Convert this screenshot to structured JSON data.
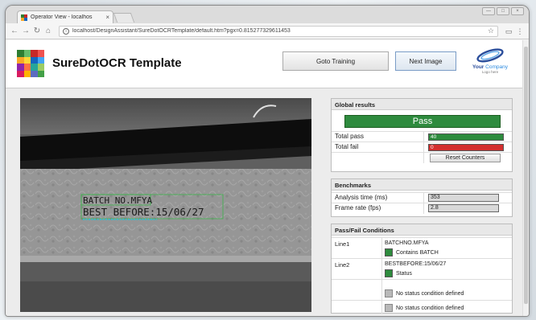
{
  "browser": {
    "tab_title": "Operator View - localhos",
    "tab_close": "×",
    "url": "localhost/DesignAssistant/SureDotOCRTemplate/default.htm?pgx=0.815277329611453",
    "win_controls": [
      "—",
      "□",
      "×"
    ]
  },
  "header": {
    "app_title": "SureDotOCR Template",
    "goto_training_label": "Goto Training",
    "next_image_label": "Next Image",
    "company_name_part1": "Your",
    "company_name_part2": "Company",
    "company_tagline": "Logo here"
  },
  "image_view": {
    "ocr_line1": "BATCH NO.MFYA",
    "ocr_line2": "BEST BEFORE:15/06/27",
    "overlay_color": "#3fb8c9"
  },
  "global_results": {
    "title": "Global results",
    "status": "Pass",
    "total_pass_label": "Total pass",
    "total_pass_value": "40",
    "total_fail_label": "Total fail",
    "total_fail_value": "0",
    "reset_label": "Reset Counters",
    "pass_color": "#2e8b3e",
    "fail_color": "#d32f2f"
  },
  "benchmarks": {
    "title": "Benchmarks",
    "analysis_label": "Analysis time (ms)",
    "analysis_value": "353",
    "framerate_label": "Frame rate (fps)",
    "framerate_value": "2.8"
  },
  "conditions": {
    "title": "Pass/Fail Conditions",
    "line1_label": "Line1",
    "line1_text": "BATCHNO.MFYA",
    "line1_status": "Contains BATCH",
    "line2_label": "Line2",
    "line2_text": "BESTBEFORE:15/06/27",
    "line2_status": "Status",
    "empty1_status": "No status condition defined",
    "empty2_status": "No status condition defined"
  }
}
